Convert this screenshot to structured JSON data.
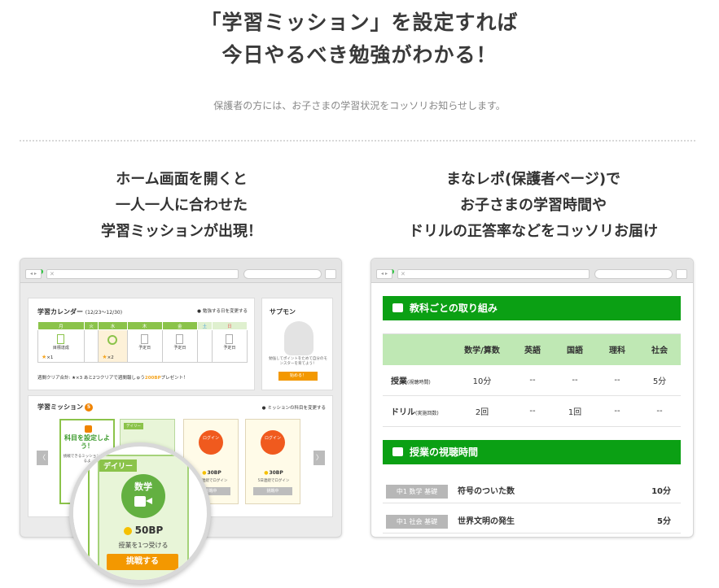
{
  "header": {
    "title_line1": "「学習ミッション」を設定すれば",
    "title_line2": "今日やるべき勉強がわかる！",
    "subtitle": "保護者の方には、お子さまの学習状況をコッソリお知らせします。"
  },
  "left_column": {
    "heading_line1": "ホーム画面を開くと",
    "heading_line2": "一人一人に合わせた",
    "heading_line3": "学習ミッションが出現！"
  },
  "right_column": {
    "heading_line1": "まなレポ(保護者ページ)で",
    "heading_line2": "お子さまの学習時間や",
    "heading_line3": "ドリルの正答率などをコッソリお届け"
  },
  "colors": {
    "accent_green": "#0ba014",
    "light_green": "#bfe8b4",
    "orange": "#f39800"
  },
  "left_browser": {
    "calendar": {
      "title": "学習カレンダー",
      "range": "(12/23〜12/30)",
      "change_link": "勉強する日を変更する",
      "days": [
        "月",
        "火",
        "水",
        "木",
        "金",
        "土",
        "日"
      ],
      "cell_mon_label": "目標達成",
      "cell_mon_star": "×1",
      "cell_wed_star": "×2",
      "cell_plan_label": "予定日",
      "footer": "週間クリア合計: ★×3 あと2つクリアで週間報しゅう",
      "footer_bp": "200BP",
      "footer_tail": "プレゼント！"
    },
    "sapumon": {
      "title": "サプモン",
      "text": "勉強してポイントをためて自分のモンスターを育てよう！",
      "button": "始める！"
    },
    "mission": {
      "title": "学習ミッション",
      "badge": "5",
      "change_link": "ミッションの科目を変更する",
      "set_card_text": "科目を設定しよう！",
      "set_card_sub": "挑戦できるミッションがふえるよ",
      "daily_tag": "デイリー",
      "daily_subject": "数学",
      "login_label": "ログイン",
      "card3_bp": "30BP",
      "card3_desc": "3日連続でログイン",
      "card4_bp": "30BP",
      "card4_desc": "5日連続でログイン",
      "card_btn": "挑戦中",
      "arrow_left": "〈",
      "arrow_right": "〉"
    }
  },
  "magnifier": {
    "tag": "デイリー",
    "subject": "数学",
    "bp": "50BP",
    "desc": "授業を1つ受ける",
    "button": "挑戦する"
  },
  "right_browser": {
    "section1_title": "教科ごとの取り組み",
    "table": {
      "headers": [
        "",
        "数学/算数",
        "英語",
        "国語",
        "理科",
        "社会"
      ],
      "rows": [
        {
          "label": "授業",
          "note": "(視聴時間)",
          "cells": [
            "10分",
            "--",
            "--",
            "--",
            "5分"
          ]
        },
        {
          "label": "ドリル",
          "note": "(実施回数)",
          "cells": [
            "2回",
            "--",
            "1回",
            "--",
            "--"
          ]
        }
      ]
    },
    "section2_title": "授業の視聴時間",
    "lessons": [
      {
        "tag": "中1 数学 基礎",
        "name": "符号のついた数",
        "time": "10分"
      },
      {
        "tag": "中1 社会 基礎",
        "name": "世界文明の発生",
        "time": "5分"
      }
    ]
  }
}
